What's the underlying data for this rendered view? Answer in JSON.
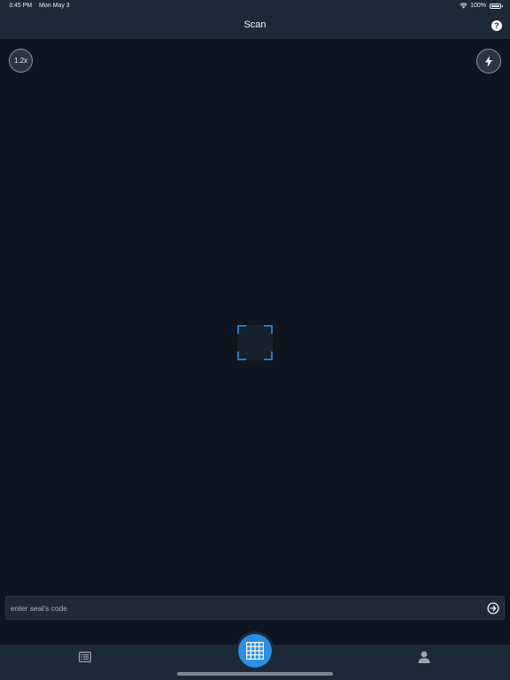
{
  "status_bar": {
    "time": "3:45 PM",
    "date": "Mon May 3",
    "battery": "100%"
  },
  "nav": {
    "title": "Scan",
    "help_icon": "?"
  },
  "camera": {
    "zoom_label": "1.2x",
    "flash_icon": "lightning-icon"
  },
  "code_entry": {
    "placeholder": "enter seal's code",
    "value": "",
    "submit_icon": "arrow-right-circle-icon"
  },
  "tabs": [
    {
      "name": "list",
      "icon": "list-icon"
    },
    {
      "name": "scan",
      "icon": "grid-icon",
      "active": true
    },
    {
      "name": "profile",
      "icon": "person-icon"
    }
  ],
  "colors": {
    "accent": "#2b8fe5",
    "background": "#0d1620",
    "bar": "#1c2937"
  }
}
